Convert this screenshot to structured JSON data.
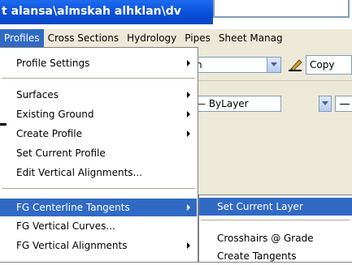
{
  "window": {
    "title": "t alansa\\almskah alhklan\\dv"
  },
  "menubar": {
    "items": [
      "Profiles",
      "Cross Sections",
      "Hydrology",
      "Pipes",
      "Sheet Manag"
    ]
  },
  "toolbar": {
    "combo1_value": "n",
    "copy_label": "Copy",
    "layer_combo_value": "— ByLayer"
  },
  "profiles_menu": {
    "items": [
      {
        "label": "Profile Settings",
        "has_submenu": true
      },
      {
        "label": "Surfaces",
        "has_submenu": true
      },
      {
        "label": "Existing Ground",
        "has_submenu": true
      },
      {
        "label": "Create Profile",
        "has_submenu": true
      },
      {
        "label": "Set Current Profile",
        "has_submenu": false
      },
      {
        "label": "Edit Vertical Alignments...",
        "has_submenu": false
      },
      {
        "label": "FG Centerline Tangents",
        "has_submenu": true,
        "highlighted": true
      },
      {
        "label": "FG Vertical Curves...",
        "has_submenu": false
      },
      {
        "label": "FG Vertical Alignments",
        "has_submenu": true
      }
    ]
  },
  "submenu": {
    "items": [
      {
        "label": "Set Current Layer",
        "highlighted": true
      },
      {
        "label": "Crosshairs @ Grade"
      },
      {
        "label": "Create Tangents"
      }
    ]
  },
  "colors": {
    "titlebar": "#0a4fd8",
    "highlight": "#316ac5",
    "menubar_bg": "#ece9d8"
  }
}
